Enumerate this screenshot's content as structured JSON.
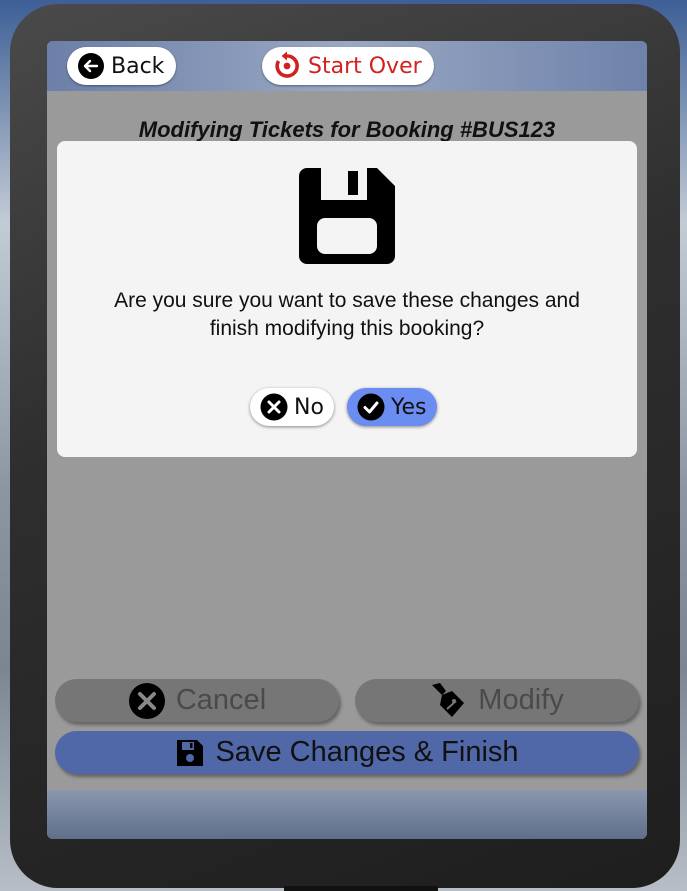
{
  "header": {
    "back_label": "Back",
    "start_over_label": "Start Over"
  },
  "page": {
    "title": "Modifying Tickets for Booking #BUS123"
  },
  "actions": {
    "cancel_label": "Cancel",
    "modify_label": "Modify",
    "save_label": "Save Changes & Finish"
  },
  "dialog": {
    "icon": "floppy-disk-icon",
    "message_line1": "Are you sure you want to save these changes and",
    "message_line2": "finish modifying this booking?",
    "no_label": "No",
    "yes_label": "Yes"
  },
  "colors": {
    "start_over": "#d32020",
    "yes_button": "#6b8cf0",
    "save_button": "#5168a8"
  }
}
